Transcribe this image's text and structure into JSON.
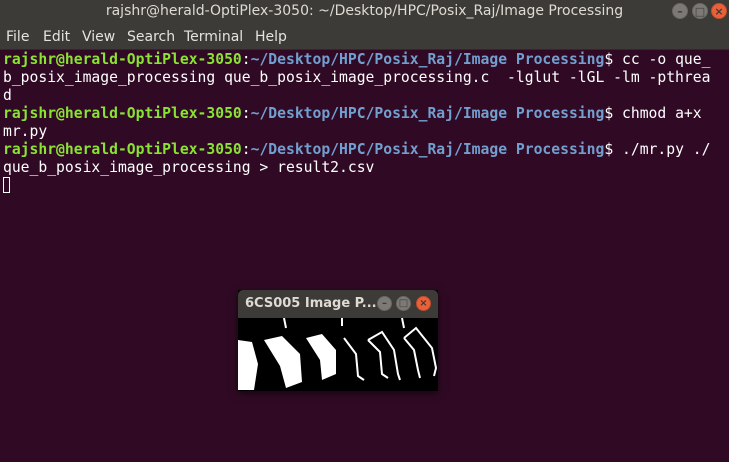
{
  "window": {
    "title": "rajshr@herald-OptiPlex-3050: ~/Desktop/HPC/Posix_Raj/Image Processing"
  },
  "menu": [
    "File",
    "Edit",
    "View",
    "Search",
    "Terminal",
    "Help"
  ],
  "terminal": {
    "user_host": "rajshr@herald-OptiPlex-3050",
    "path": "~/Desktop/HPC/Posix_Raj/Image Processing",
    "lines": [
      {
        "prompt": true,
        "text": "$ cc -o que_"
      },
      {
        "prompt": false,
        "text": "b_posix_image_processing que_b_posix_image_processing.c  -lglut -lGL -lm -pthrea"
      },
      {
        "prompt": false,
        "text": "d"
      },
      {
        "prompt": true,
        "text": "$ chmod a+x"
      },
      {
        "prompt": false,
        "text": "mr.py"
      },
      {
        "prompt": true,
        "text": "$ ./mr.py ./"
      },
      {
        "prompt": false,
        "text": "que_b_posix_image_processing > result2.csv"
      }
    ]
  },
  "popup": {
    "title": "6CS005 Image P..."
  },
  "colors": {
    "background": "#300a24",
    "user": "#8ae234",
    "path": "#729fcf",
    "close": "#e9603a"
  }
}
